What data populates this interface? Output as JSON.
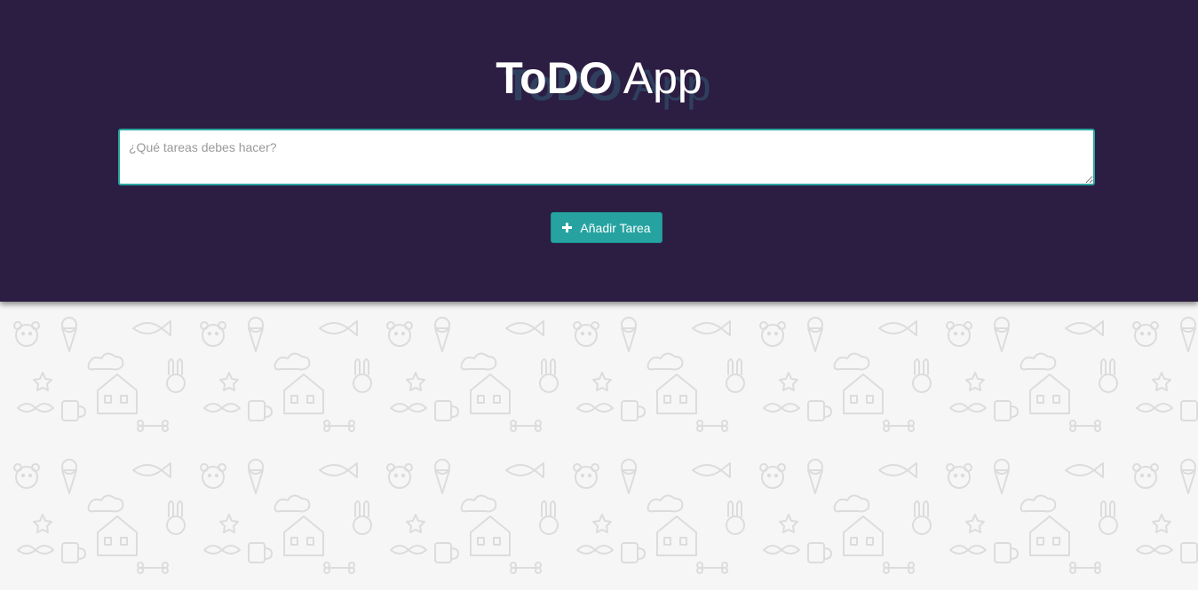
{
  "app": {
    "title_bold": "ToDO",
    "title_regular": "App"
  },
  "task_input": {
    "placeholder": "¿Qué tareas debes hacer?",
    "value": ""
  },
  "add_button": {
    "label": "Añadir Tarea",
    "icon": "plus-icon"
  },
  "colors": {
    "header_bg": "#2c1d42",
    "accent": "#26a3a1",
    "page_bg": "#f6f6f6",
    "doodle": "#dedede"
  }
}
